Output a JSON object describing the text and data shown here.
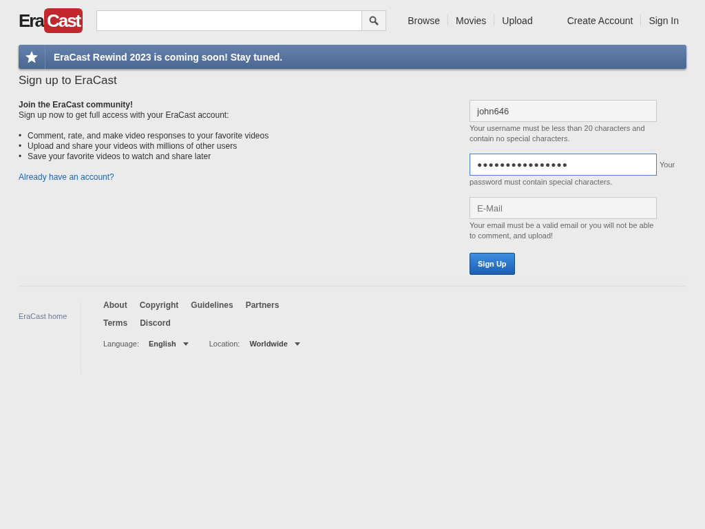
{
  "header": {
    "logo": {
      "part_1": "Era",
      "part_2": "Cast"
    },
    "nav": [
      {
        "label": "Browse"
      },
      {
        "label": "Movies"
      },
      {
        "label": "Upload"
      }
    ],
    "account_links": [
      {
        "label": "Create Account"
      },
      {
        "label": "Sign In"
      }
    ]
  },
  "alert": {
    "message": "EraCast Rewind 2023 is coming soon! Stay tuned."
  },
  "page_title": "Sign up to EraCast",
  "intro": {
    "heading": "Join the EraCast community!",
    "text": "Sign up now to get full access with your EraCast account:",
    "bullets": [
      {
        "bullet": "•",
        "text": "Comment, rate, and make video responses to your favorite videos"
      },
      {
        "bullet": "•",
        "text": "Upload and share your videos with millions of other users"
      },
      {
        "bullet": "•",
        "text": "Save your favorite videos to watch and share later"
      }
    ],
    "login_link": "Already have an account?"
  },
  "form": {
    "fields": [
      {
        "kind": "text",
        "value": "john646",
        "focused": false,
        "hint": "Your username must be less than 20 characters and contain no special characters."
      },
      {
        "kind": "password",
        "value": "●●●●●●●●●●●●●●●●",
        "focused": true,
        "hint_start": "Your",
        "hint_rest": "password must contain special characters."
      },
      {
        "kind": "email",
        "placeholder": "E-Mail",
        "focused": false,
        "hint": "Your email must be a valid email or you will not be able to comment, and upload!"
      }
    ],
    "submit": "Sign Up"
  },
  "footer": {
    "home_link": "EraCast home",
    "links": [
      {
        "label": "About"
      },
      {
        "label": "Copyright"
      },
      {
        "label": "Guidelines"
      },
      {
        "label": "Partners"
      },
      {
        "label": "Terms"
      },
      {
        "label": "Discord"
      }
    ],
    "language": {
      "label": "Language:",
      "value": "English"
    },
    "location": {
      "label": "Location:",
      "value": "Worldwide"
    }
  }
}
